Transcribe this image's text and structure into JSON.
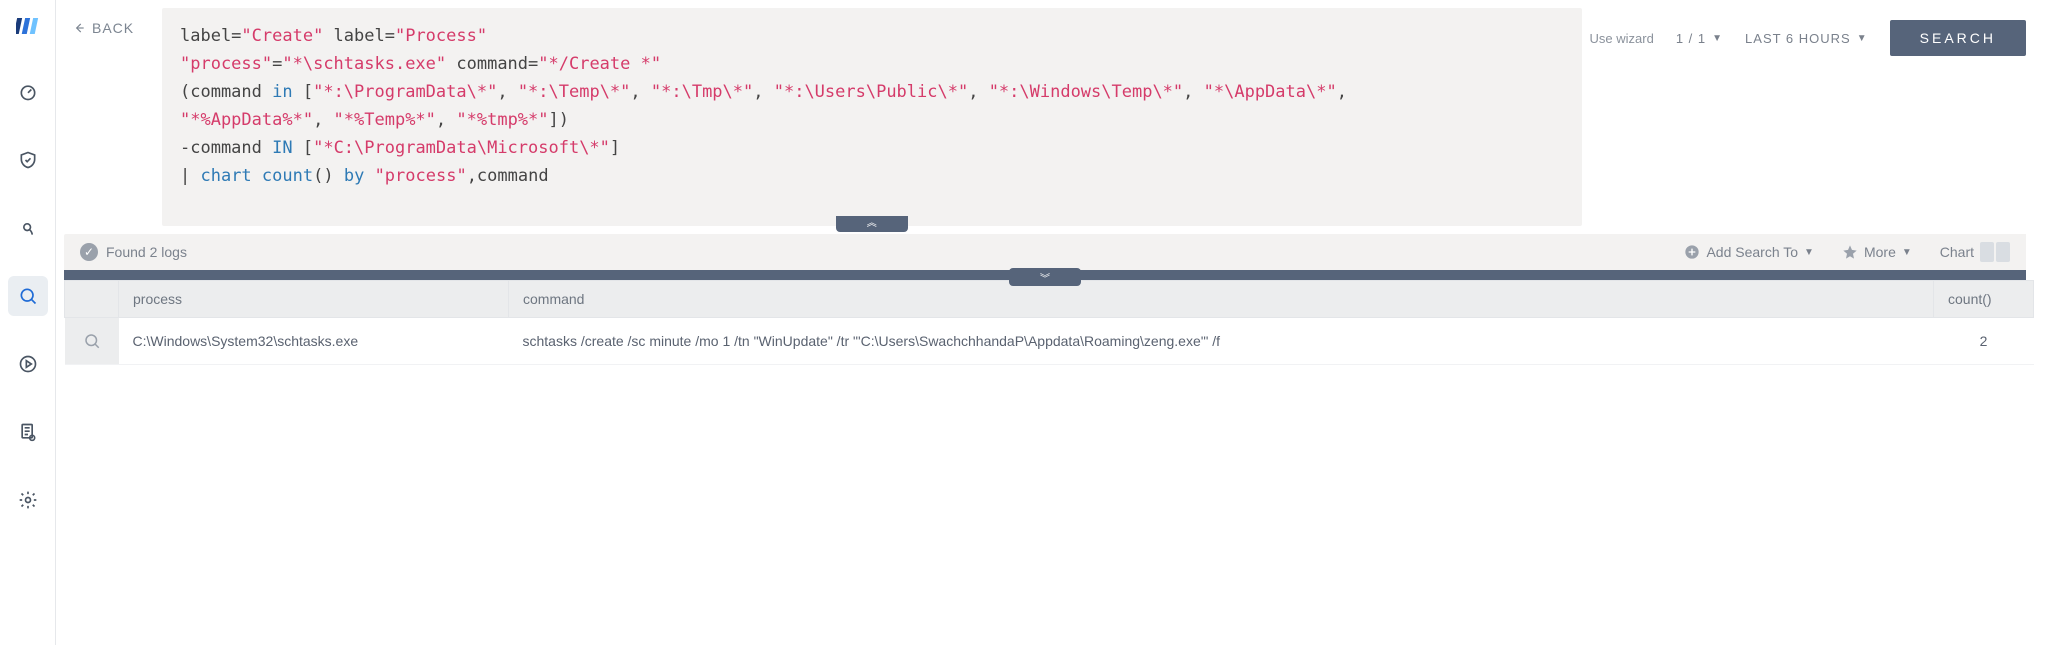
{
  "back_label": "BACK",
  "query": {
    "line1a": "label=",
    "line1b": "\"Create\"",
    "line1c": " label=",
    "line1d": "\"Process\"",
    "line2a": "\"process\"",
    "line2b": "=",
    "line2c": "\"*\\schtasks.exe\"",
    "line2d": " command=",
    "line2e": "\"*/Create *\"",
    "line3a": "(command ",
    "line3b": "in",
    "line3c": " [",
    "line3d": "\"*:\\ProgramData\\*\"",
    "line3e": ", ",
    "line3f": "\"*:\\Temp\\*\"",
    "line3g": ", ",
    "line3h": "\"*:\\Tmp\\*\"",
    "line3i": ", ",
    "line3j": "\"*:\\Users\\Public\\*\"",
    "line3k": ", ",
    "line3l": "\"*:\\Windows\\Temp\\*\"",
    "line3m": ", ",
    "line3n": "\"*\\AppData\\*\"",
    "line3o": ",",
    "line4a": "\"*%AppData%*\"",
    "line4b": ", ",
    "line4c": "\"*%Temp%*\"",
    "line4d": ", ",
    "line4e": "\"*%tmp%*\"",
    "line4f": "])",
    "line5a": "-command ",
    "line5b": "IN",
    "line5c": " [",
    "line5d": "\"*C:\\ProgramData\\Microsoft\\*\"",
    "line5e": "]",
    "line6a": "| ",
    "line6b": "chart",
    "line6c": " ",
    "line6d": "count",
    "line6e": "() ",
    "line6f": "by",
    "line6g": " ",
    "line6h": "\"process\"",
    "line6i": ",command"
  },
  "wizard_label": "Use wizard",
  "page_indicator": "1 / 1",
  "range_label": "LAST 6 HOURS",
  "search_label": "SEARCH",
  "collapse_glyph": "︽",
  "expand_glyph": "︾",
  "results_bar": {
    "found_label": "Found 2 logs",
    "add_search_to": "Add Search To",
    "more_label": "More",
    "chart_label": "Chart"
  },
  "table": {
    "headers": {
      "process": "process",
      "command": "command",
      "count": "count()"
    },
    "rows": [
      {
        "process": "C:\\Windows\\System32\\schtasks.exe",
        "command": "schtasks /create /sc minute /mo 1 /tn \"WinUpdate\" /tr \"'C:\\Users\\SwachchhandaP\\Appdata\\Roaming\\zeng.exe'\" /f",
        "count": "2"
      }
    ]
  }
}
